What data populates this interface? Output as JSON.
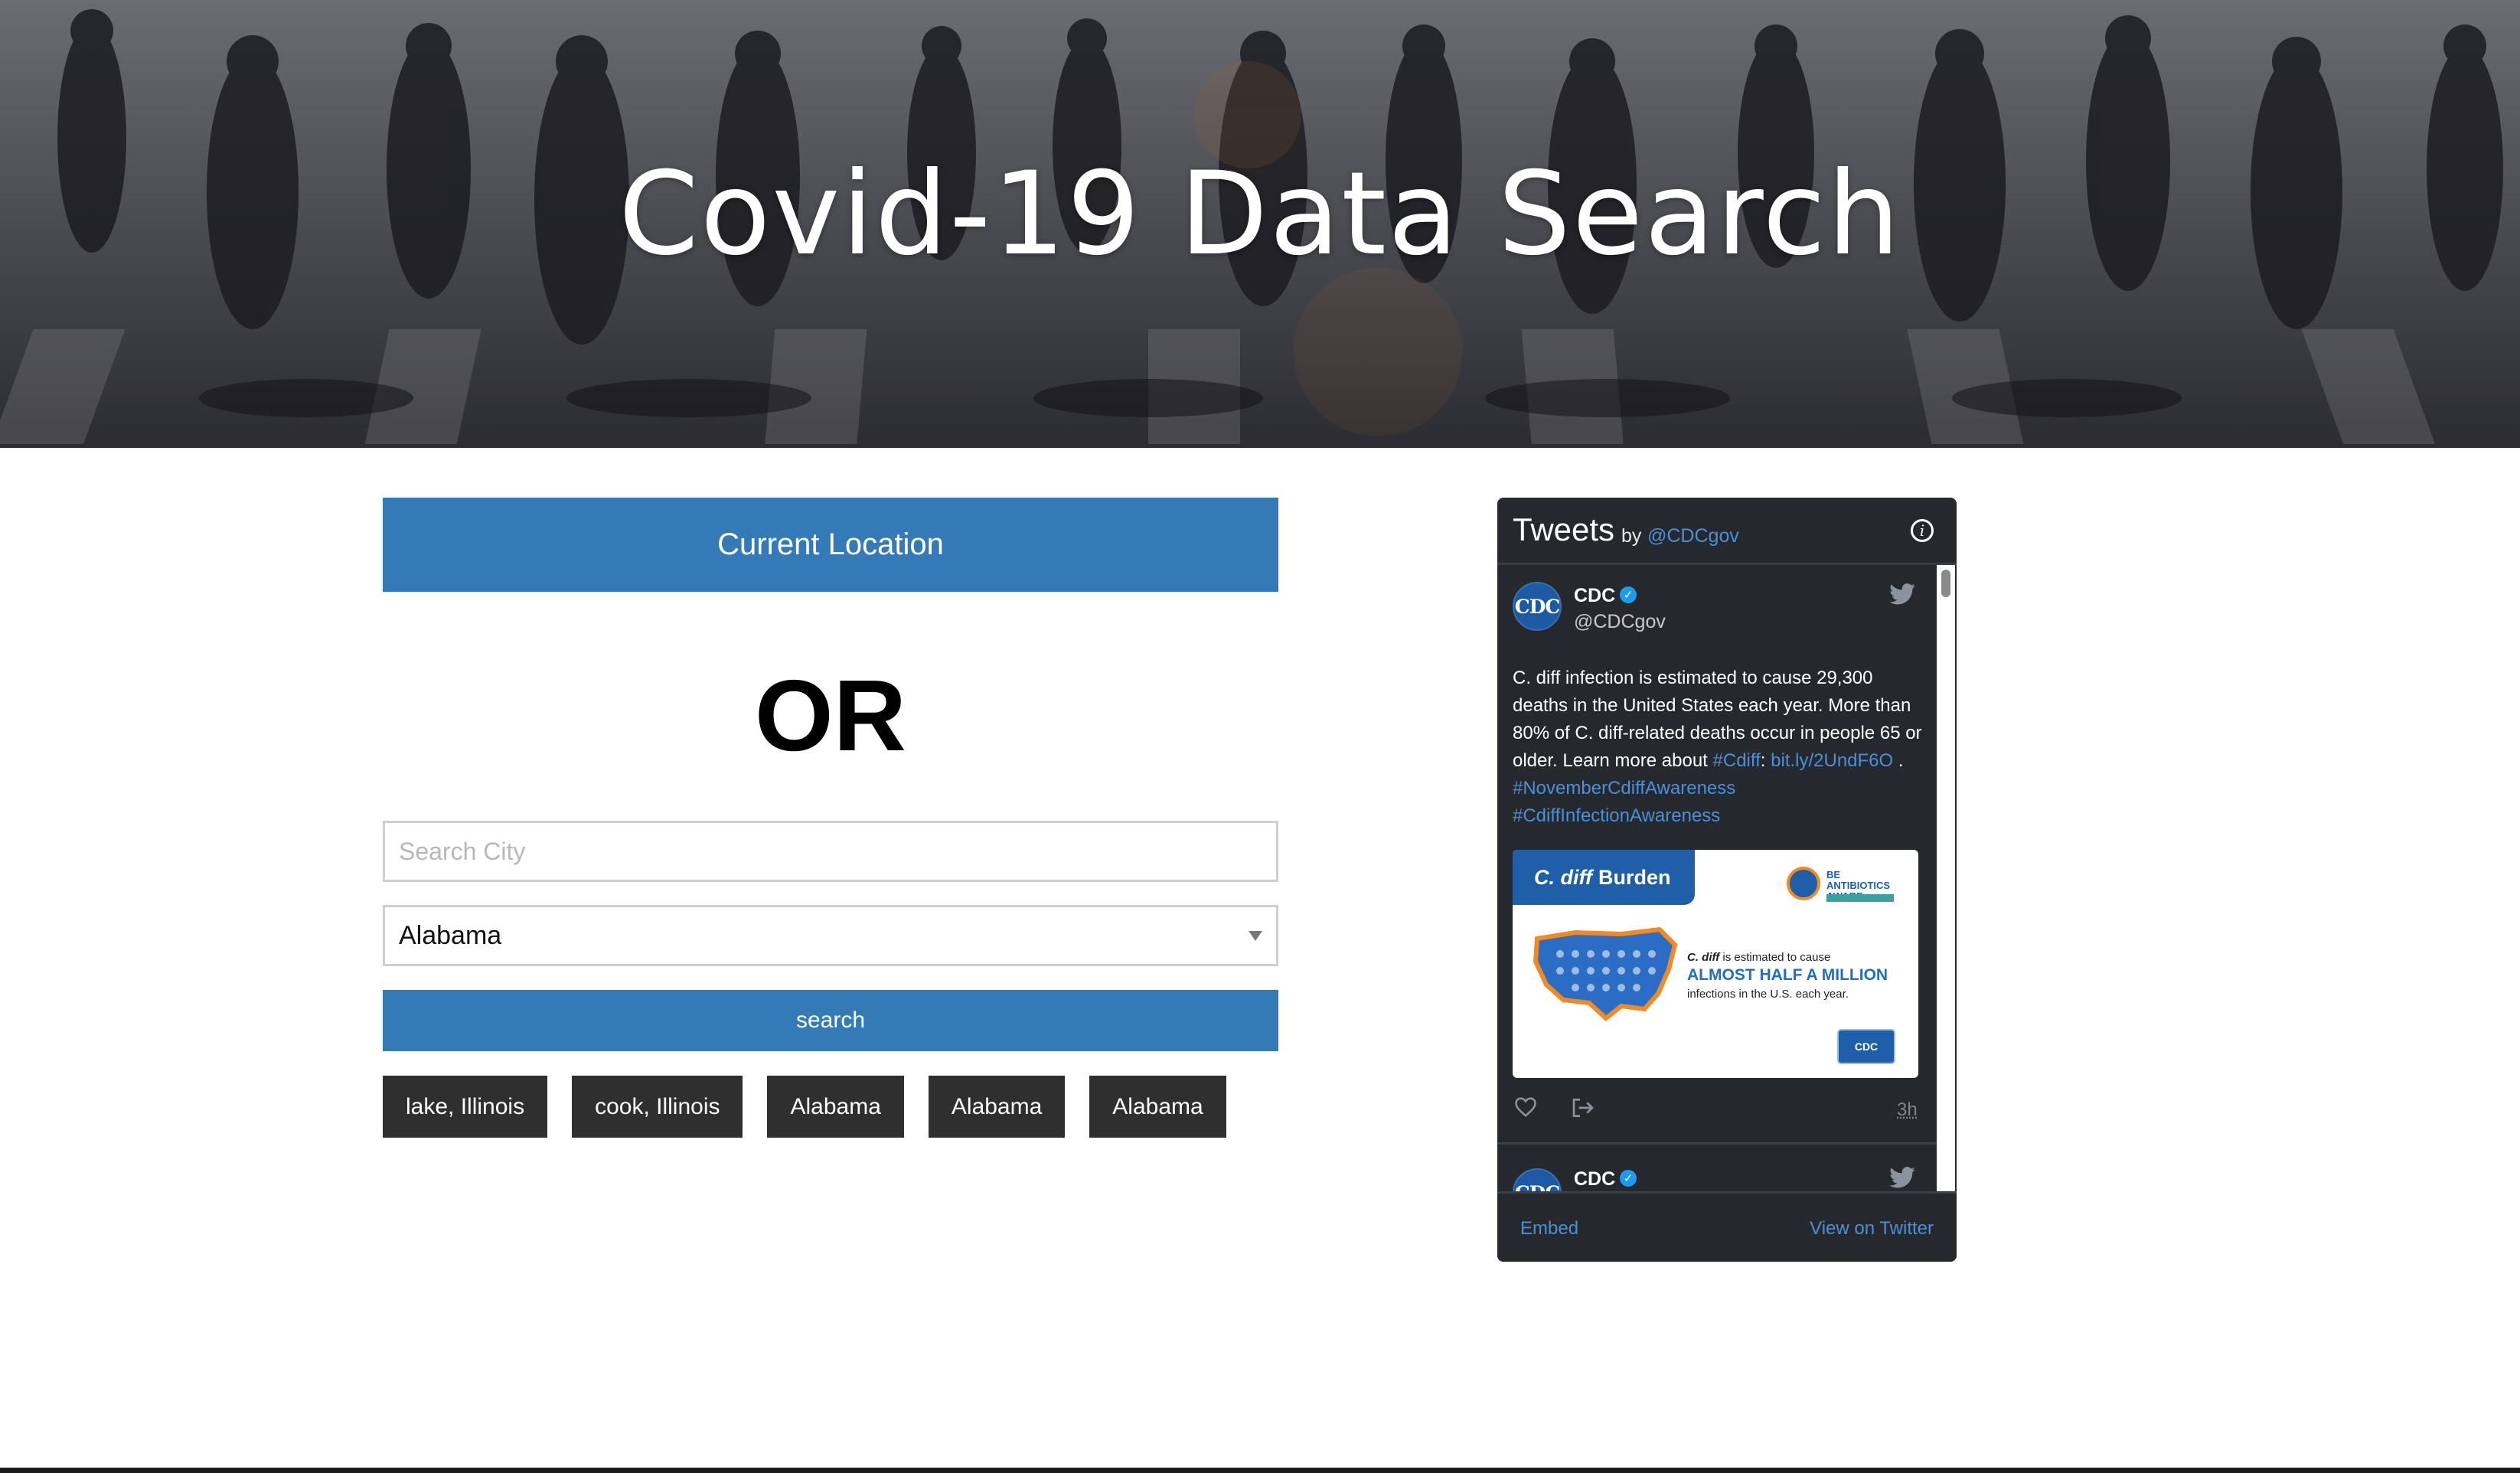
{
  "hero": {
    "title": "Covid-19 Data Search"
  },
  "search_panel": {
    "current_location_label": "Current Location",
    "or_label": "OR",
    "city_placeholder": "Search City",
    "city_value": "",
    "state_selected": "Alabama",
    "search_label": "search",
    "history": [
      "lake, Illinois",
      "cook, Illinois",
      "Alabama",
      "Alabama",
      "Alabama"
    ]
  },
  "twitter": {
    "title": "Tweets",
    "by": "by",
    "account_link": "@CDCgov",
    "tweets": [
      {
        "name": "CDC",
        "handle": "@CDCgov",
        "avatar_text": "CDC",
        "text": "C. diff infection is estimated to cause 29,300 deaths in the United States each year. More than 80% of C. diff-related deaths occur in people 65 or older. Learn more about",
        "hashtag1": "#Cdiff",
        "colon": ":",
        "link": "bit.ly/2UndF6O",
        "period": ".",
        "hashtag2": "#NovemberCdiffAwareness",
        "hashtag3": "#CdiffInfectionAwareness",
        "time": "3h",
        "card": {
          "tab_italic": "C. diff",
          "tab_text": "Burden",
          "logo_text": "BE ANTIBIOTICS AWARE",
          "line1_italic": "C. diff",
          "line1_text": "is estimated to cause",
          "line2": "ALMOST HALF A MILLION",
          "line3": "infections in the U.S. each year.",
          "badge": "CDC"
        }
      },
      {
        "name": "CDC",
        "avatar_text": "CDC"
      }
    ],
    "embed_label": "Embed",
    "view_label": "View on Twitter"
  },
  "colors": {
    "primary_button": "#337ab7",
    "history_chip": "#2f2f2f",
    "widget_bg": "#25292e",
    "link": "#4a8fd8"
  },
  "icons": [
    "info-icon",
    "verified-icon",
    "twitter-bird-icon",
    "heart-icon",
    "share-icon",
    "select-arrow-icon"
  ]
}
